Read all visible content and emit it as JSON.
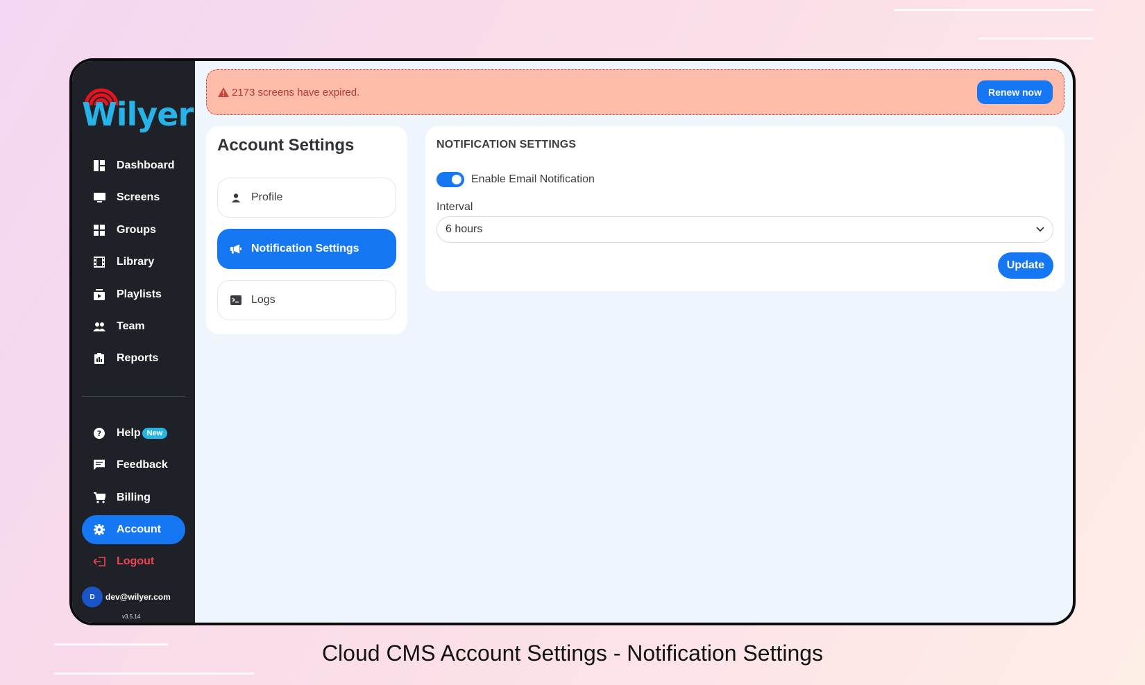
{
  "brand": {
    "name": "Wilyer",
    "color": "#27b2e8",
    "signal_color": "#e5141c"
  },
  "sidebar": {
    "items": [
      {
        "label": "Dashboard",
        "icon": "dashboard-icon"
      },
      {
        "label": "Screens",
        "icon": "monitor-icon"
      },
      {
        "label": "Groups",
        "icon": "grid-icon"
      },
      {
        "label": "Library",
        "icon": "film-icon"
      },
      {
        "label": "Playlists",
        "icon": "playlist-icon"
      },
      {
        "label": "Team",
        "icon": "team-icon"
      },
      {
        "label": "Reports",
        "icon": "clipboard-icon"
      }
    ],
    "secondary": [
      {
        "label": "Help",
        "icon": "help-icon",
        "badge": "New"
      },
      {
        "label": "Feedback",
        "icon": "chat-icon"
      },
      {
        "label": "Billing",
        "icon": "cart-icon"
      },
      {
        "label": "Account",
        "icon": "gear-icon",
        "active": true
      },
      {
        "label": "Logout",
        "icon": "logout-icon"
      }
    ],
    "user": {
      "initial": "D",
      "email": "dev@wilyer.com"
    },
    "version": "v3.5.14"
  },
  "alert": {
    "message": "2173 screens have expired.",
    "action_label": "Renew now"
  },
  "account_settings": {
    "title": "Account Settings",
    "menu": [
      {
        "label": "Profile",
        "icon": "user-icon"
      },
      {
        "label": "Notification Settings",
        "icon": "megaphone-icon",
        "active": true
      },
      {
        "label": "Logs",
        "icon": "terminal-icon"
      }
    ]
  },
  "notification_settings": {
    "title": "NOTIFICATION SETTINGS",
    "toggle_label": "Enable Email Notification",
    "toggle_on": true,
    "interval_label": "Interval",
    "interval_value": "6 hours",
    "update_label": "Update"
  },
  "caption": "Cloud CMS Account Settings - Notification Settings",
  "colors": {
    "accent": "#1577f4",
    "sidebar_bg": "#1e2228",
    "alert_bg": "#fdbba9",
    "danger": "#f0454f"
  }
}
